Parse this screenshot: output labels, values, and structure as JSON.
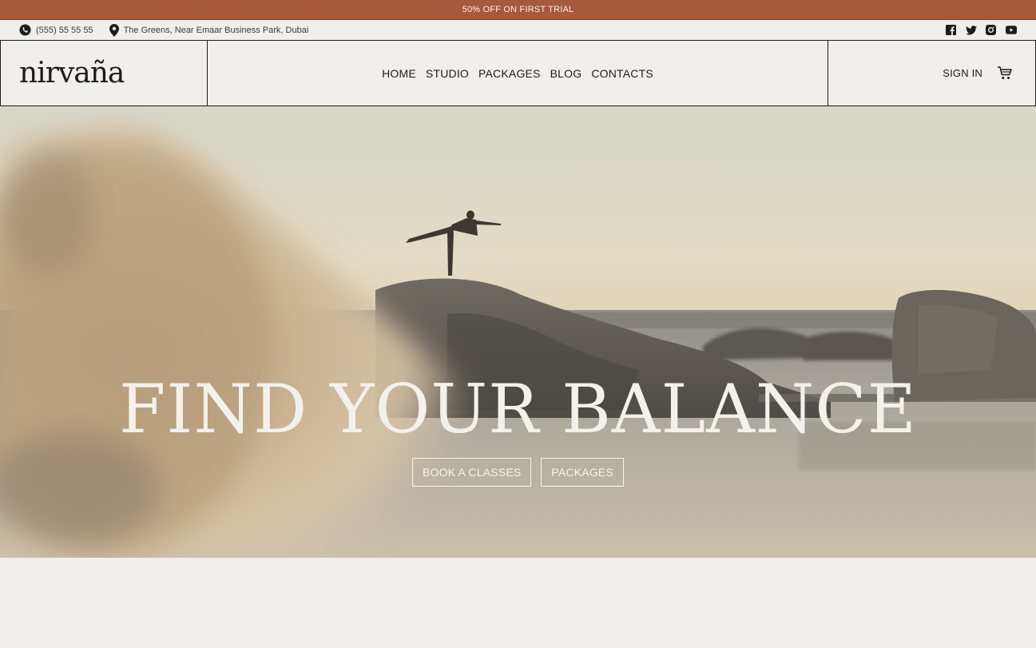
{
  "promo": {
    "text": "50% OFF ON FIRST TRIAL",
    "background": "#a65a3a"
  },
  "infobar": {
    "phone": {
      "icon": "phone-icon",
      "text": "(555) 55 55 55"
    },
    "address": {
      "icon": "location-pin-icon",
      "text": "The Greens, Near Emaar Business Park, Dubai"
    },
    "socials": [
      {
        "name": "facebook-icon"
      },
      {
        "name": "twitter-icon"
      },
      {
        "name": "instagram-icon"
      },
      {
        "name": "youtube-icon"
      }
    ]
  },
  "header": {
    "logo": "nirvaña",
    "nav": [
      "HOME",
      "STUDIO",
      "PACKAGES",
      "BLOG",
      "CONTACTS"
    ],
    "signin": "SIGN IN",
    "cart_icon": "cart-icon"
  },
  "hero": {
    "title": "FIND YOUR BALANCE",
    "buttons": [
      "BOOK A CLASSES",
      "PACKAGES"
    ],
    "image": "woman doing yoga balance pose on rocks by the sea at sunset"
  }
}
